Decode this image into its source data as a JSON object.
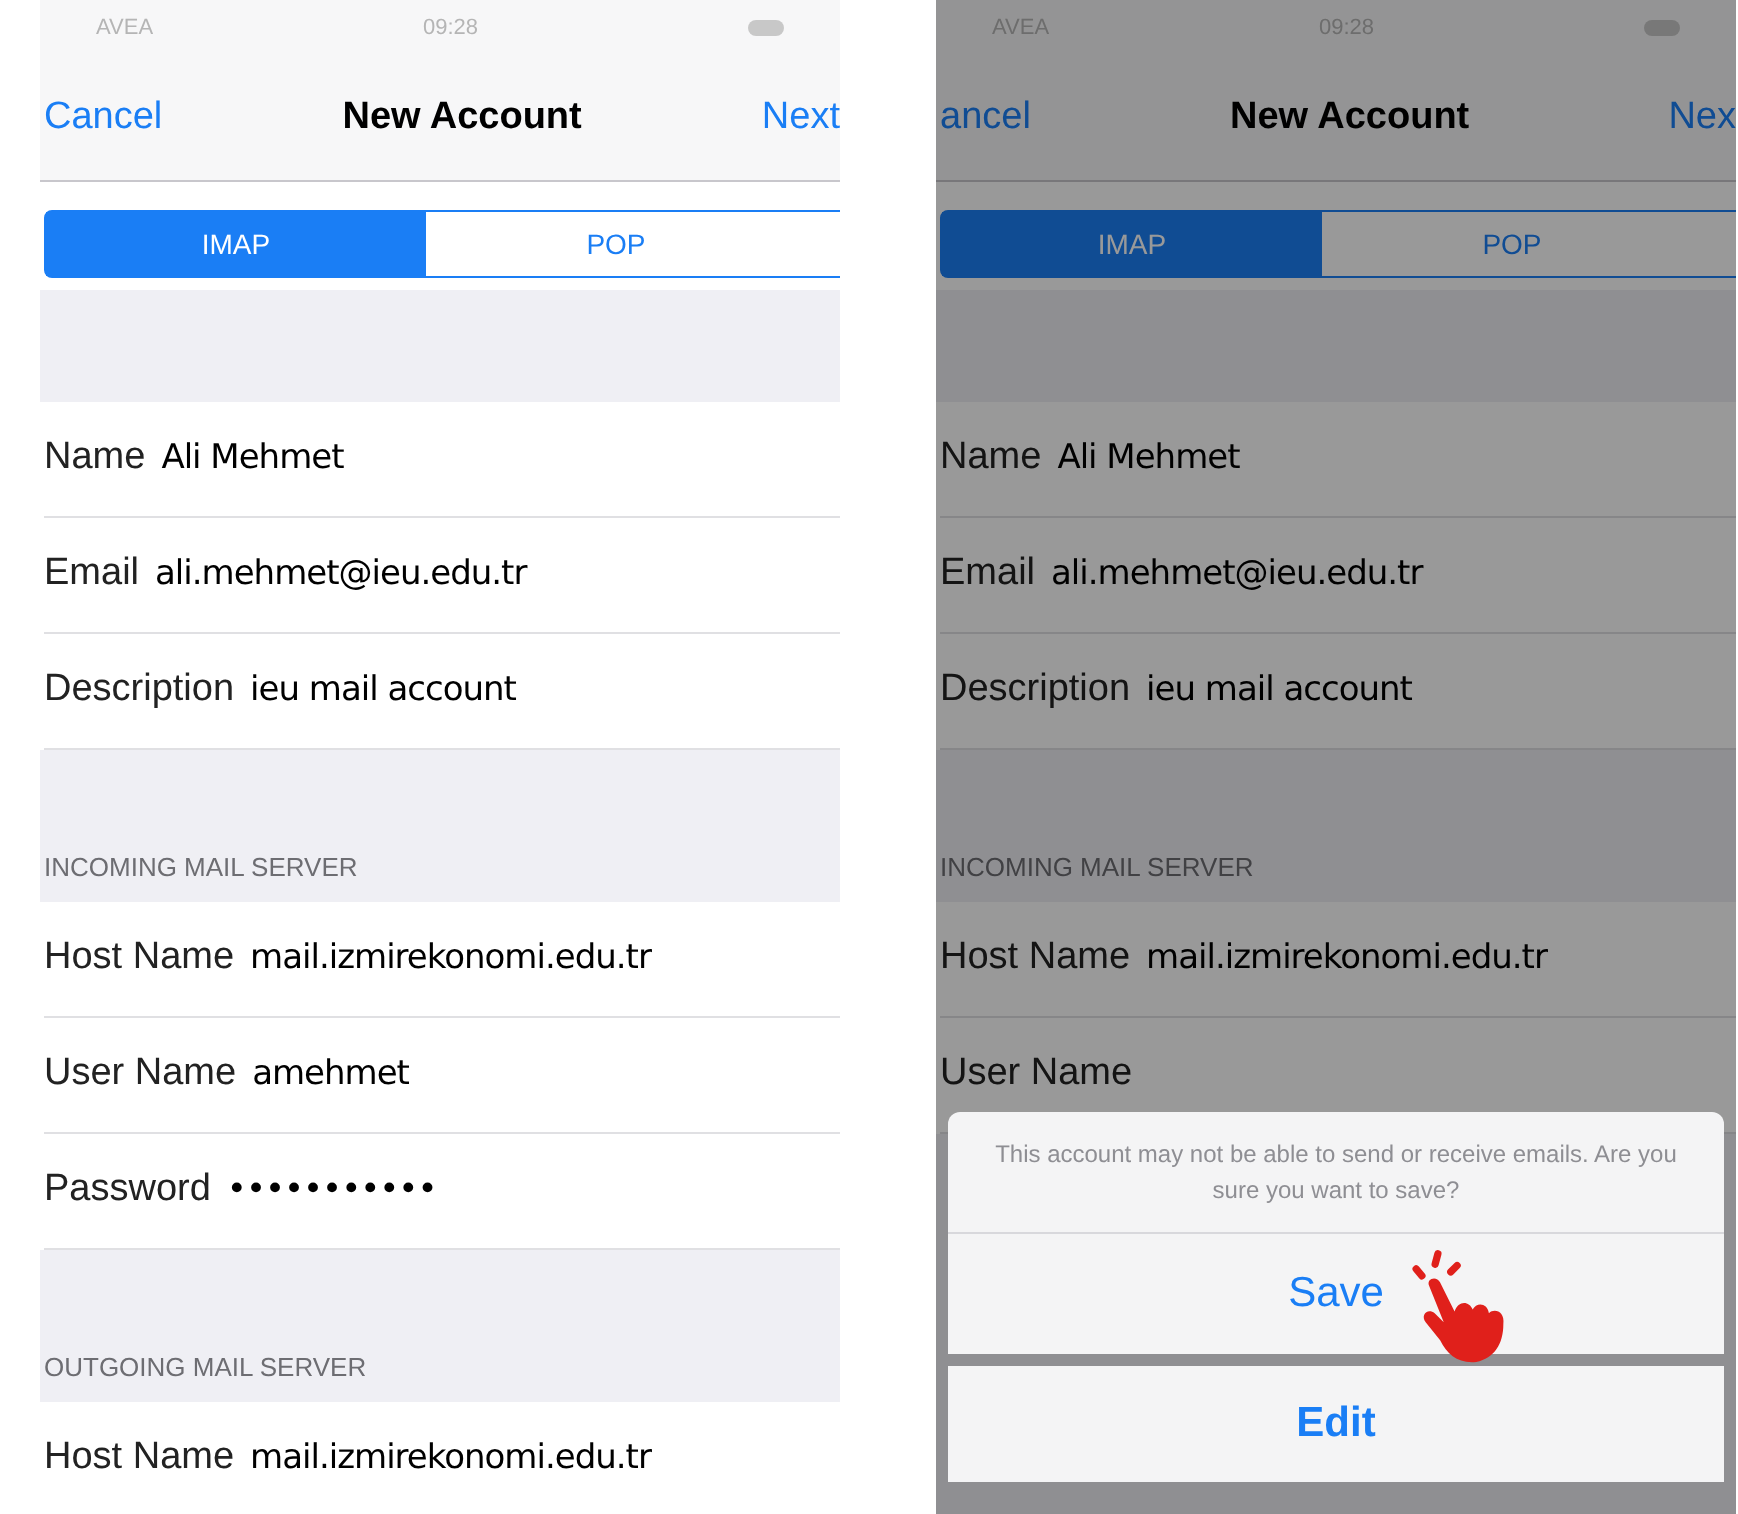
{
  "screens": [
    {
      "dimmed": false,
      "status_bar": {
        "carrier": "AVEA",
        "time": "09:28"
      },
      "nav": {
        "left": "Cancel",
        "title": "New Account",
        "right": "Next"
      },
      "segments": [
        {
          "label": "IMAP",
          "selected": true
        },
        {
          "label": "POP",
          "selected": false
        }
      ],
      "sections": [
        {
          "rows": [
            {
              "label": "Name",
              "value": "Ali Mehmet"
            },
            {
              "label": "Email",
              "value": "ali.mehmet@ieu.edu.tr"
            },
            {
              "label": "Description",
              "value": "ieu mail account"
            }
          ]
        },
        {
          "header": "INCOMING MAIL SERVER",
          "rows": [
            {
              "label": "Host Name",
              "value": "mail.izmirekonomi.edu.tr"
            },
            {
              "label": "User Name",
              "value": "amehmet"
            },
            {
              "label": "Password",
              "value": "•••••••••••"
            }
          ]
        },
        {
          "header": "OUTGOING MAIL SERVER",
          "rows": [
            {
              "label": "Host Name",
              "value": "mail.izmirekonomi.edu.tr"
            }
          ]
        }
      ]
    },
    {
      "dimmed": true,
      "status_bar": {
        "carrier": "AVEA",
        "time": "09:28"
      },
      "nav": {
        "left": "ancel",
        "title": "New Account",
        "right": "Nex"
      },
      "segments": [
        {
          "label": "IMAP",
          "selected": true
        },
        {
          "label": "POP",
          "selected": false
        }
      ],
      "sections": [
        {
          "rows": [
            {
              "label": "Name",
              "value": "Ali Mehmet"
            },
            {
              "label": "Email",
              "value": "ali.mehmet@ieu.edu.tr"
            },
            {
              "label": "Description",
              "value": "ieu mail account"
            }
          ]
        },
        {
          "header": "INCOMING MAIL SERVER",
          "rows": [
            {
              "label": "Host Name",
              "value": "mail.izmirekonomi.edu.tr"
            },
            {
              "label": "User Name"
            }
          ]
        }
      ],
      "action_sheet": {
        "message": "This account may not be able to send or receive emails. Are you sure you want to save?",
        "buttons": [
          "Save",
          "Edit"
        ]
      }
    }
  ]
}
